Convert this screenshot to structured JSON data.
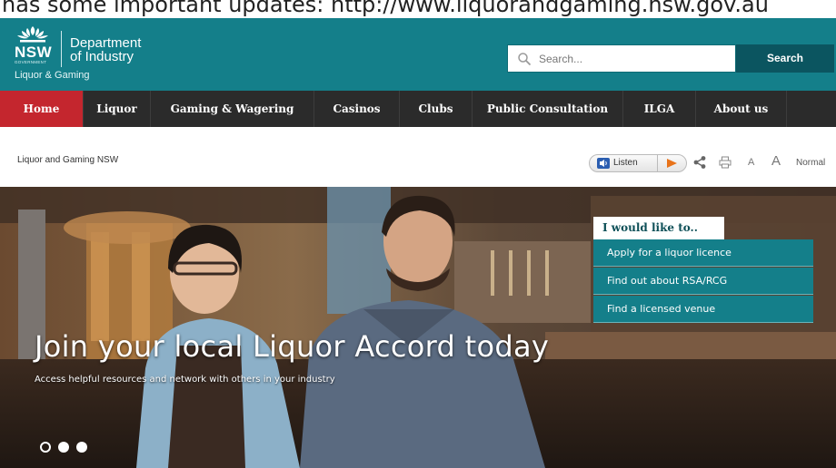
{
  "caption": "has some important updates: http://www.liquorandgaming.nsw.gov.au",
  "header": {
    "logo_nsw": "NSW",
    "logo_government": "GOVERNMENT",
    "department_line1": "Department",
    "department_line2": "of Industry",
    "subbrand": "Liquor & Gaming",
    "search_placeholder": "Search...",
    "search_button": "Search"
  },
  "nav": {
    "items": [
      {
        "label": "Home",
        "active": true
      },
      {
        "label": "Liquor",
        "active": false
      },
      {
        "label": "Gaming & Wagering",
        "active": false
      },
      {
        "label": "Casinos",
        "active": false
      },
      {
        "label": "Clubs",
        "active": false
      },
      {
        "label": "Public Consultation",
        "active": false
      },
      {
        "label": "ILGA",
        "active": false
      },
      {
        "label": "About us",
        "active": false
      }
    ]
  },
  "utility": {
    "breadcrumb": "Liquor and Gaming NSW",
    "listen": "Listen",
    "font_small": "A",
    "font_large": "A",
    "font_normal": "Normal"
  },
  "hero": {
    "title": "Join your local Liquor Accord today",
    "subtitle": "Access helpful resources and network with others in your industry",
    "slide_count": 3,
    "active_slide": 1
  },
  "quick_links": {
    "heading": "I would like to..",
    "items": [
      "Apply for a liquor licence",
      "Find out about RSA/RCG",
      "Find a licensed venue"
    ]
  },
  "colors": {
    "header_teal": "#147f8a",
    "nav_dark": "#2b2b2b",
    "nav_active_red": "#c4262e",
    "search_button": "#0b5560",
    "listen_play_orange": "#e8731a"
  }
}
